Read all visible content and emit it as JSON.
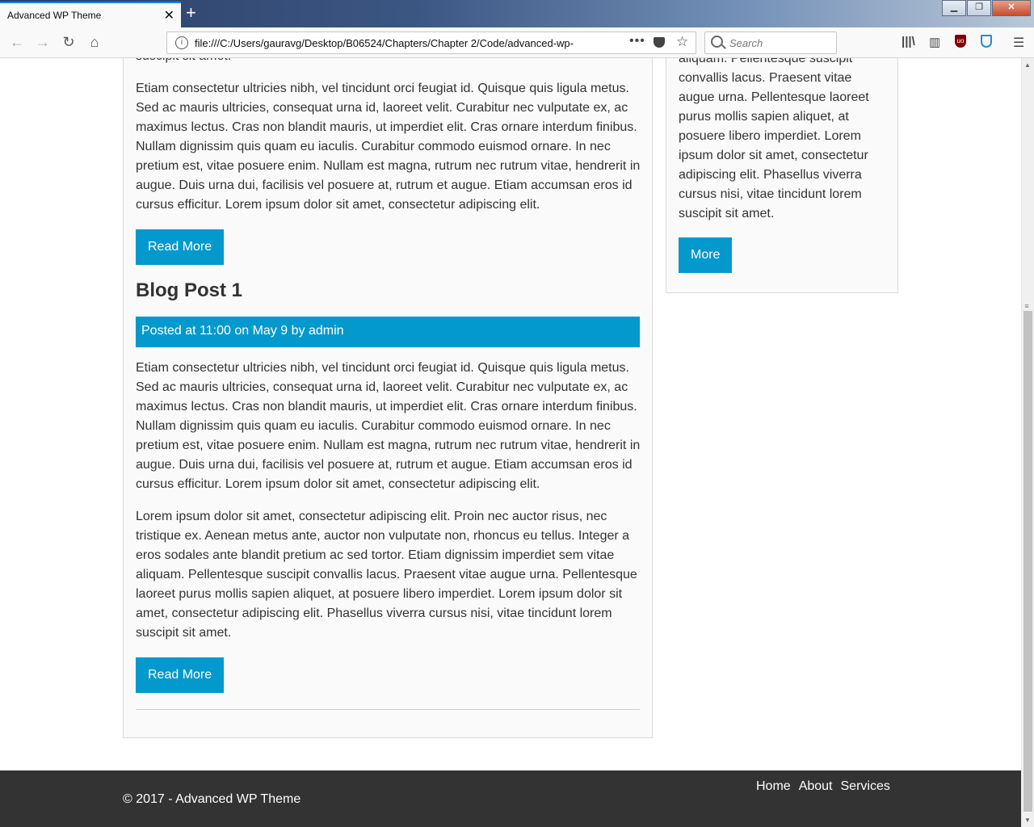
{
  "browser": {
    "tab_title": "Advanced WP Theme",
    "url": "file:///C:/Users/gauravg/Desktop/B06524/Chapters/Chapter 2/Code/advanced-wp-",
    "search_placeholder": "Search",
    "new_tab": "+",
    "tab_close": "✕",
    "url_menu": "•••"
  },
  "main": {
    "top_fragment": "suscipit sit amet.",
    "post0_paragraph2": "Etiam consectetur ultricies nibh, vel tincidunt orci feugiat id. Quisque quis ligula metus. Sed ac mauris ultricies, consequat urna id, laoreet velit. Curabitur nec vulputate ex, ac maximus lectus. Cras non blandit mauris, ut imperdiet elit. Cras ornare interdum finibus. Nullam dignissim quis quam eu iaculis. Curabitur commodo euismod ornare. In nec pretium est, vitae posuere enim. Nullam est magna, rutrum nec rutrum vitae, hendrerit in augue. Duis urna dui, facilisis vel posuere at, rutrum et augue. Etiam accumsan eros id cursus efficitur. Lorem ipsum dolor sit amet, consectetur adipiscing elit.",
    "read_more_label": "Read More",
    "post1": {
      "title": "Blog Post 1",
      "meta": "Posted at 11:00 on May 9 by admin",
      "paragraph1": "Etiam consectetur ultricies nibh, vel tincidunt orci feugiat id. Quisque quis ligula metus. Sed ac mauris ultricies, consequat urna id, laoreet velit. Curabitur nec vulputate ex, ac maximus lectus. Cras non blandit mauris, ut imperdiet elit. Cras ornare interdum finibus. Nullam dignissim quis quam eu iaculis. Curabitur commodo euismod ornare. In nec pretium est, vitae posuere enim. Nullam est magna, rutrum nec rutrum vitae, hendrerit in augue. Duis urna dui, facilisis vel posuere at, rutrum et augue. Etiam accumsan eros id cursus efficitur. Lorem ipsum dolor sit amet, consectetur adipiscing elit.",
      "paragraph2": "Lorem ipsum dolor sit amet, consectetur adipiscing elit. Proin nec auctor risus, nec tristique ex. Aenean metus ante, auctor non vulputate non, rhoncus eu tellus. Integer a eros sodales ante blandit pretium ac sed tortor. Etiam dignissim imperdiet sem vitae aliquam. Pellentesque suscipit convallis lacus. Praesent vitae augue urna. Pellentesque laoreet purus mollis sapien aliquet, at posuere libero imperdiet. Lorem ipsum dolor sit amet, consectetur adipiscing elit. Phasellus viverra cursus nisi, vitae tincidunt lorem suscipit sit amet."
    }
  },
  "sidebar": {
    "text": "aliquam. Pellentesque suscipit convallis lacus. Praesent vitae augue urna. Pellentesque laoreet purus mollis sapien aliquet, at posuere libero imperdiet. Lorem ipsum dolor sit amet, consectetur adipiscing elit. Phasellus viverra cursus nisi, vitae tincidunt lorem suscipit sit amet.",
    "more_label": "More"
  },
  "footer": {
    "copyright": "© 2017 - Advanced WP Theme",
    "nav": [
      "Home",
      "About",
      "Services"
    ]
  },
  "colors": {
    "accent": "#0399cc",
    "footer_bg": "#333333",
    "box_bg": "#fafafa"
  }
}
